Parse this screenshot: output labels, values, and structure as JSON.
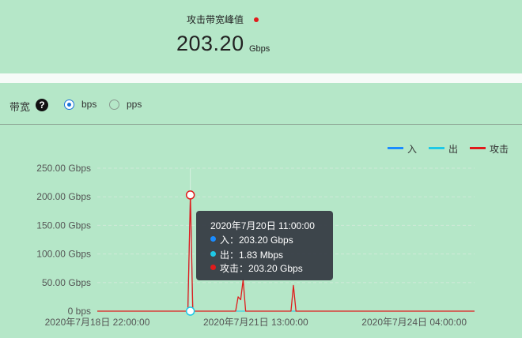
{
  "peak": {
    "label": "攻击带宽峰值",
    "value": "203.20",
    "unit": "Gbps",
    "indicator_color": "#e01b1b"
  },
  "controls": {
    "bandwidth_label": "带宽",
    "help_icon": "?",
    "radio_options": [
      {
        "label": "bps",
        "selected": true
      },
      {
        "label": "pps",
        "selected": false
      }
    ]
  },
  "legend": [
    {
      "name": "入",
      "color": "#1a8cff"
    },
    {
      "name": "出",
      "color": "#1fc9e6"
    },
    {
      "name": "攻击",
      "color": "#e01b1b"
    }
  ],
  "tooltip": {
    "title": "2020年7月20日 11:00:00",
    "rows": [
      {
        "text": "入：203.20 Gbps",
        "color": "#1a8cff"
      },
      {
        "text": "出：1.83 Mbps",
        "color": "#1fc9e6"
      },
      {
        "text": "攻击：203.20 Gbps",
        "color": "#e01b1b"
      }
    ]
  },
  "chart_data": {
    "type": "line",
    "y_ticks": [
      "0 bps",
      "50.00 Gbps",
      "100.00 Gbps",
      "150.00 Gbps",
      "200.00 Gbps",
      "250.00 Gbps"
    ],
    "y_tick_values": [
      0,
      50,
      100,
      150,
      200,
      250
    ],
    "ylim": [
      0,
      250
    ],
    "x_ticks": [
      "2020年7月18日 22:00:00",
      "2020年7月21日 13:00:00",
      "2020年7月24日 04:00:00"
    ],
    "x_tick_values": [
      0,
      63,
      126
    ],
    "xlim": [
      0,
      150
    ],
    "x_unit": "hours since first tick",
    "grid": true,
    "legend_position": "top-right",
    "series": [
      {
        "name": "入",
        "color": "#1a8cff",
        "points": [
          [
            0,
            0
          ],
          [
            36,
            0
          ],
          [
            37,
            203.2
          ],
          [
            38,
            0
          ],
          [
            150,
            0
          ]
        ]
      },
      {
        "name": "出",
        "color": "#1fc9e6",
        "points": [
          [
            0,
            0
          ],
          [
            150,
            0
          ]
        ]
      },
      {
        "name": "攻击",
        "color": "#e01b1b",
        "points": [
          [
            0,
            0
          ],
          [
            36,
            0
          ],
          [
            37,
            203.2
          ],
          [
            38,
            0
          ],
          [
            55,
            0
          ],
          [
            56,
            25
          ],
          [
            57,
            20
          ],
          [
            58,
            55
          ],
          [
            59,
            0
          ],
          [
            77,
            0
          ],
          [
            78,
            45
          ],
          [
            79,
            0
          ],
          [
            150,
            0
          ]
        ]
      }
    ],
    "highlight": {
      "x": 37,
      "values": [
        203.2,
        0
      ]
    }
  }
}
